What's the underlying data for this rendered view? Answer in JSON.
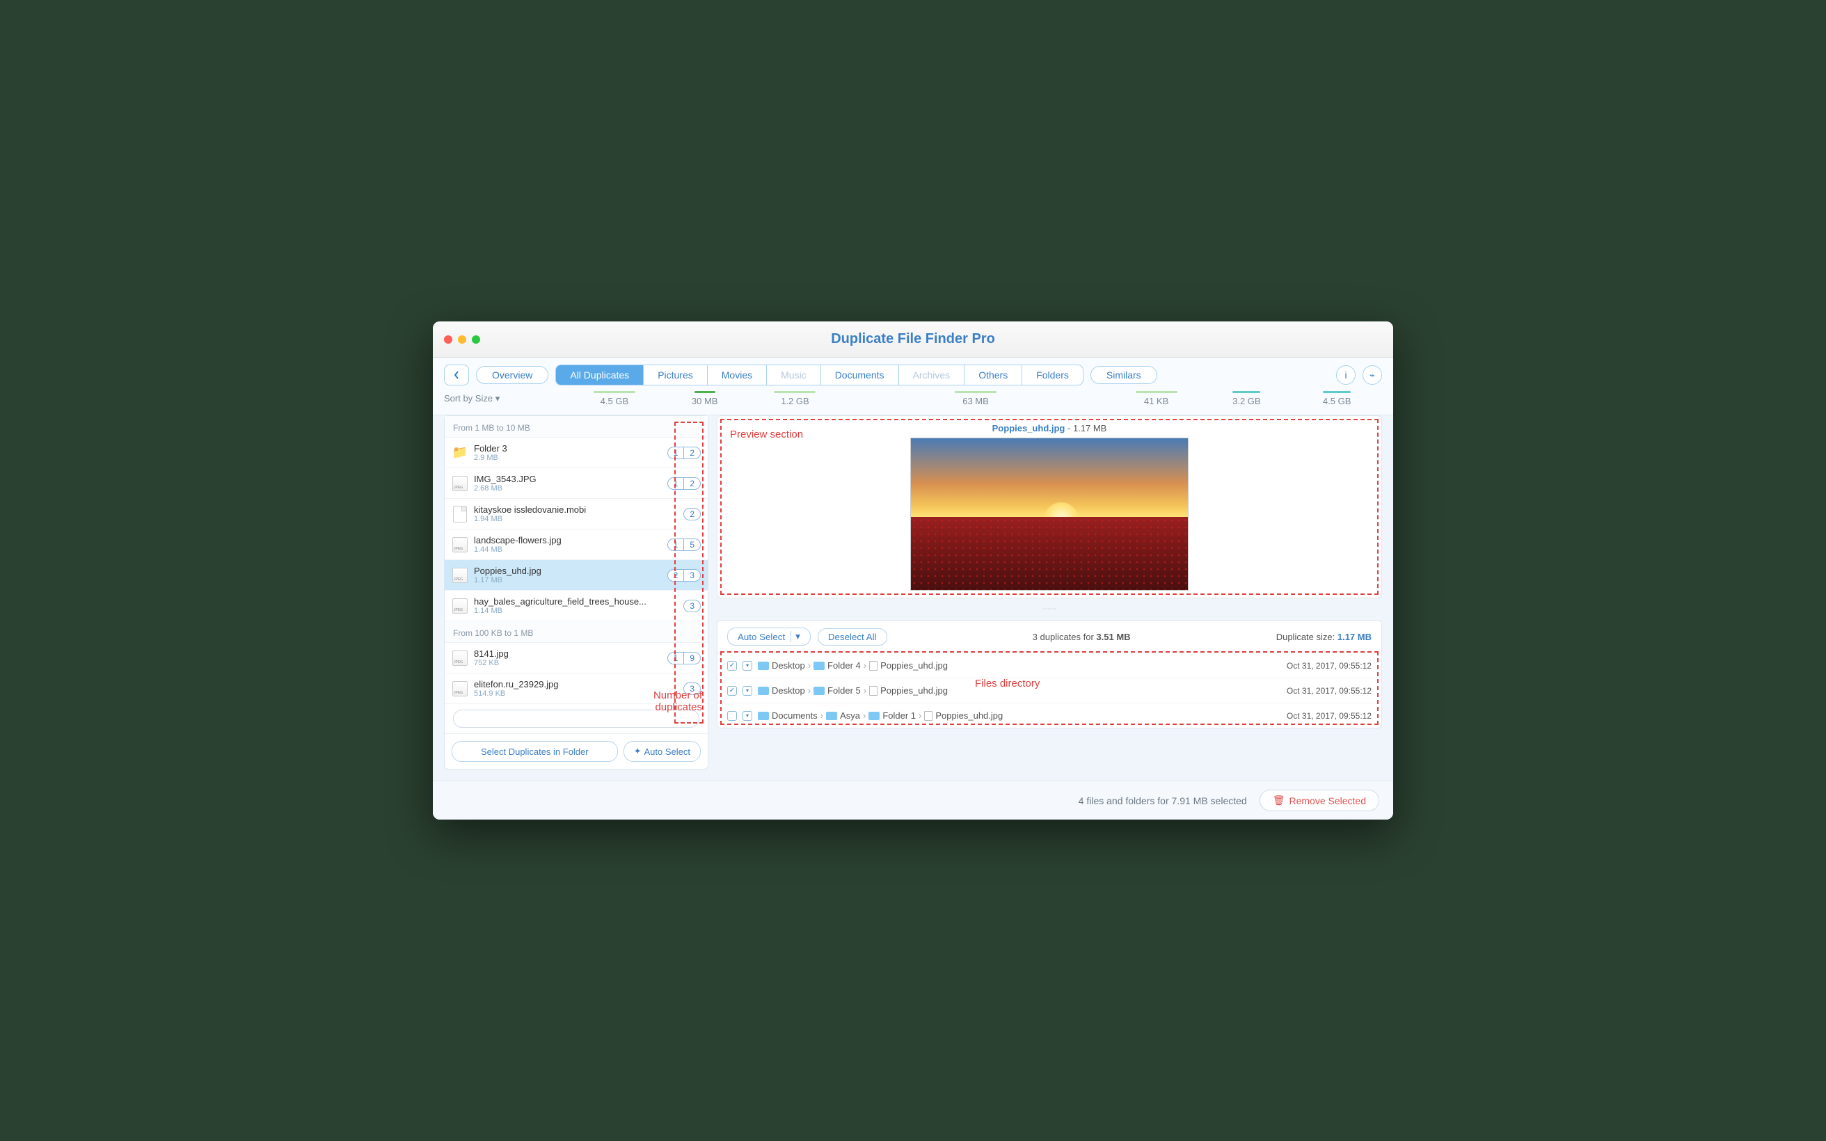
{
  "window": {
    "title": "Duplicate File Finder Pro"
  },
  "toolbar": {
    "overview": "Overview",
    "tabs": [
      {
        "label": "All Duplicates",
        "size": "4.5 GB",
        "active": true
      },
      {
        "label": "Pictures",
        "size": "30 MB"
      },
      {
        "label": "Movies",
        "size": "1.2 GB"
      },
      {
        "label": "Music",
        "size": "",
        "disabled": true
      },
      {
        "label": "Documents",
        "size": "63 MB"
      },
      {
        "label": "Archives",
        "size": "",
        "disabled": true
      },
      {
        "label": "Others",
        "size": "41 KB"
      },
      {
        "label": "Folders",
        "size": "3.2 GB"
      }
    ],
    "similars": "Similars",
    "similars_size": "4.5 GB",
    "sort": "Sort by Size"
  },
  "sidebar": {
    "groups": [
      {
        "header": "From 1 MB to 10 MB",
        "items": [
          {
            "name": "Folder 3",
            "size": "2.9 MB",
            "icon": "folder",
            "sel": "1",
            "count": "2"
          },
          {
            "name": "IMG_3543.JPG",
            "size": "2.68 MB",
            "icon": "jpeg",
            "sel": "1",
            "count": "2"
          },
          {
            "name": "kitayskoe issledovanie.mobi",
            "size": "1.94 MB",
            "icon": "doc",
            "count": "2"
          },
          {
            "name": "landscape-flowers.jpg",
            "size": "1.44 MB",
            "icon": "jpeg",
            "sel": "1",
            "count": "5"
          },
          {
            "name": "Poppies_uhd.jpg",
            "size": "1.17 MB",
            "icon": "jpeg",
            "sel": "2",
            "count": "3",
            "selected": true
          },
          {
            "name": "hay_bales_agriculture_field_trees_house...",
            "size": "1.14 MB",
            "icon": "jpeg",
            "count": "3"
          }
        ]
      },
      {
        "header": "From 100 KB to 1 MB",
        "items": [
          {
            "name": "8141.jpg",
            "size": "752 KB",
            "icon": "jpeg",
            "sel": "1",
            "count": "9"
          },
          {
            "name": "elitefon.ru_23929.jpg",
            "size": "514.9 KB",
            "icon": "jpeg",
            "count": "3"
          }
        ]
      }
    ],
    "select_in_folder": "Select Duplicates in Folder",
    "auto_select": "Auto Select"
  },
  "preview": {
    "filename": "Poppies_uhd.jpg",
    "size": "1.17 MB"
  },
  "duplicates": {
    "auto_select": "Auto Select",
    "deselect_all": "Deselect All",
    "count_text_prefix": "3 duplicates for ",
    "count_text_bold": "3.51 MB",
    "dup_size_prefix": "Duplicate size: ",
    "dup_size_bold": "1.17 MB",
    "rows": [
      {
        "checked": true,
        "path": [
          "Desktop",
          "Folder 4",
          "Poppies_uhd.jpg"
        ],
        "ts": "Oct 31, 2017, 09:55:12"
      },
      {
        "checked": true,
        "path": [
          "Desktop",
          "Folder 5",
          "Poppies_uhd.jpg"
        ],
        "ts": "Oct 31, 2017, 09:55:12"
      },
      {
        "checked": false,
        "path": [
          "Documents",
          "Asya",
          "Folder 1",
          "Poppies_uhd.jpg"
        ],
        "ts": "Oct 31, 2017, 09:55:12"
      }
    ]
  },
  "footer": {
    "status": "4 files and folders for 7.91 MB selected",
    "remove": "Remove Selected"
  },
  "annotations": {
    "preview": "Preview section",
    "directory": "Files directory",
    "number": "Number of\nduplicates"
  }
}
